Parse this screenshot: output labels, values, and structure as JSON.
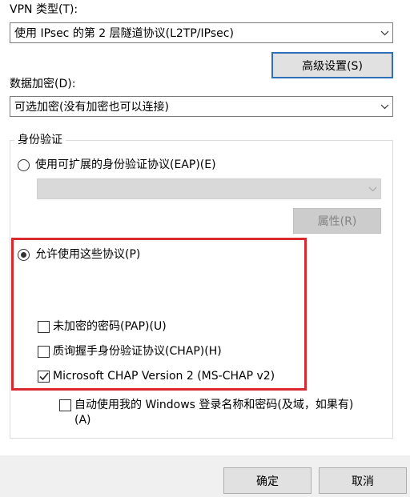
{
  "vpn_type": {
    "label": "VPN 类型(T):",
    "selected": "使用 IPsec 的第 2 层隧道协议(L2TP/IPsec)"
  },
  "advanced_button": "高级设置(S)",
  "data_encryption": {
    "label": "数据加密(D):",
    "selected": "可选加密(没有加密也可以连接)"
  },
  "authentication": {
    "title": "身份验证",
    "eap_radio": "使用可扩展的身份验证协议(EAP)(E)",
    "eap_selected": "",
    "properties_button": "属性(R)",
    "allow_protocols_radio": "允许使用这些协议(P)",
    "protocols": [
      {
        "label": "未加密的密码(PAP)(U)",
        "checked": false
      },
      {
        "label": "质询握手身份验证协议(CHAP)(H)",
        "checked": false
      },
      {
        "label": "Microsoft CHAP Version 2 (MS-CHAP v2)",
        "checked": true
      }
    ],
    "auto_windows_logon": {
      "line1": "自动使用我的 Windows 登录名称和密码(及域，如果有)",
      "line2": "(A)",
      "checked": false
    }
  },
  "footer": {
    "ok": "确定",
    "cancel": "取消"
  },
  "colors": {
    "highlight": "#d92a2f",
    "default_button_border": "#2f6fb7"
  }
}
